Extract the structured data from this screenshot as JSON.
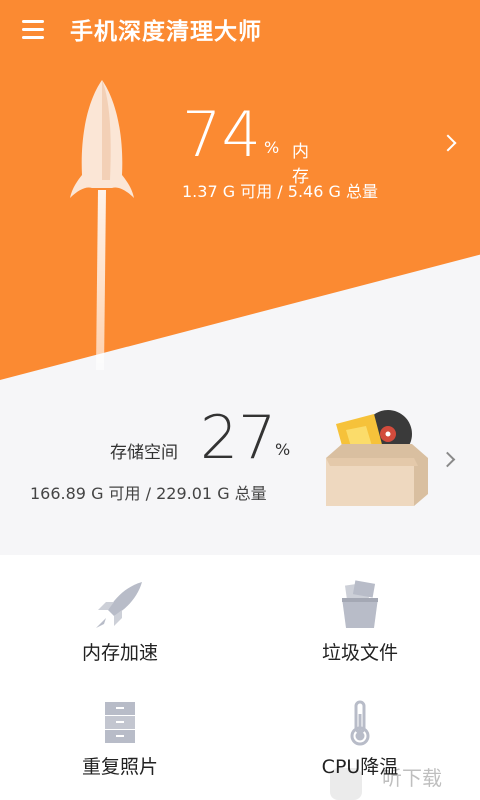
{
  "app": {
    "title": "手机深度清理大师"
  },
  "memory": {
    "percent": "74",
    "unit": "%",
    "label": "内存",
    "detail": "1.37 G 可用 / 5.46 G 总量"
  },
  "storage": {
    "label": "存储空间",
    "percent": "27",
    "unit": "%",
    "detail": "166.89 G 可用 / 229.01 G 总量"
  },
  "features": [
    {
      "label": "内存加速",
      "icon": "rocket-icon"
    },
    {
      "label": "垃圾文件",
      "icon": "trash-icon"
    },
    {
      "label": "重复照片",
      "icon": "cabinet-icon"
    },
    {
      "label": "CPU降温",
      "icon": "thermometer-icon"
    }
  ],
  "watermark": {
    "text": "听下载"
  },
  "colors": {
    "accent": "#fb8a32",
    "panel": "#f6f6f8",
    "icon": "#b8bcc8"
  }
}
